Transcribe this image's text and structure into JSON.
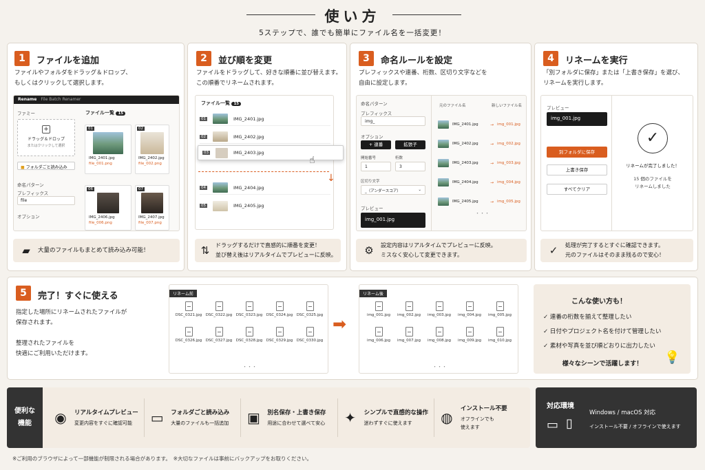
{
  "header": {
    "title": "使い方",
    "subtitle": "5ステップで、誰でも簡単にファイル名を一括変更！"
  },
  "step1": {
    "num": "1",
    "title": "ファイルを追加",
    "desc1": "ファイルやフォルダをドラッグ＆ドロップ、",
    "desc2": "もしくはクリックして選択します。",
    "app_name": "Rename",
    "app_sub": "File Batch Renamer",
    "files_label": "ファミー",
    "list_label": "ファイル一覧",
    "count": "15",
    "drop1": "ドラッグ＆ドロップ",
    "drop2": "またはクリックして選択",
    "folder_btn": "フォルダごと読み込み",
    "naming_label": "命名パターン",
    "prefix_label": "プレフィックス",
    "prefix_value": "file",
    "option_label": "オプション",
    "files": [
      {
        "n": "01",
        "a": "IMG_2401.jpg",
        "b": "file_001.png"
      },
      {
        "n": "02",
        "a": "IMG_2402.jpg",
        "b": "file_002.png"
      },
      {
        "n": "06",
        "a": "IMG_2406.jpg",
        "b": "file_006.png"
      },
      {
        "n": "07",
        "a": "IMG_2407.jpg",
        "b": "file_007.png"
      }
    ],
    "tip": "大量のファイルもまとめて読み込み可能！"
  },
  "step2": {
    "num": "2",
    "title": "並び順を変更",
    "desc1": "ファイルをドラッグして、好きな順番に並び替えます。",
    "desc2": "この順番でリネームされます。",
    "list_label": "ファイル一覧",
    "count": "15",
    "rows": [
      {
        "n": "01",
        "f": "IMG_2401.jpg"
      },
      {
        "n": "02",
        "f": "IMG_2402.jpg"
      },
      {
        "n": "03",
        "f": "IMG_2403.jpg"
      },
      {
        "n": "04",
        "f": "IMG_2404.jpg"
      },
      {
        "n": "05",
        "f": "IMG_2405.jpg"
      }
    ],
    "tip1": "ドラッグするだけで直感的に順番を変更！",
    "tip2": "並び替え後はリアルタイムでプレビューに反映。"
  },
  "step3": {
    "num": "3",
    "title": "命名ルールを設定",
    "desc1": "プレフィックスや連番、桁数、区切り文字などを",
    "desc2": "自由に設定します。",
    "naming_label": "命名パターン",
    "prefix_label": "プレフィックス",
    "prefix_value": "img_",
    "option_label": "オプション",
    "btn_seq": "+ 連番",
    "btn_ext": "拡張子",
    "start_label": "開始番号",
    "digits_label": "桁数",
    "start_value": "1",
    "digits_value": "3",
    "sep_label": "区切り文字",
    "sep_value": "_（アンダースコア）",
    "preview_label": "プレビュー",
    "preview_value": "img_001.jpg",
    "col_old": "元のファイル名",
    "col_new": "新しいファイル名",
    "rows": [
      {
        "a": "IMG_2401.jpg",
        "b": "img_001.jpg"
      },
      {
        "a": "IMG_2402.jpg",
        "b": "img_002.jpg"
      },
      {
        "a": "IMG_2403.jpg",
        "b": "img_003.jpg"
      },
      {
        "a": "IMG_2404.jpg",
        "b": "img_004.jpg"
      },
      {
        "a": "IMG_2405.jpg",
        "b": "img_005.jpg"
      }
    ],
    "tip1": "設定内容はリアルタイムでプレビューに反映。",
    "tip2": "ミスなく安心して変更できます。"
  },
  "step4": {
    "num": "4",
    "title": "リネームを実行",
    "desc1": "「別フォルダに保存」または「上書き保存」を選び、",
    "desc2": "リネームを実行します。",
    "preview_label": "プレビュー",
    "preview_value": "img_001.jpg",
    "btn_save_other": "別フォルダに保存",
    "btn_overwrite": "上書き保存",
    "btn_clear": "すべてクリア",
    "done": "リネームが完了しました！",
    "count1": "15 個のファイルを",
    "count2": "リネームしました",
    "tip1": "処理が完了するとすぐに確認できます。",
    "tip2": "元のファイルはそのまま残るので安心！"
  },
  "step5": {
    "num": "5",
    "title": "完了！すぐに使える",
    "desc1": "指定した場所にリネームされたファイルが",
    "desc2": "保存されます。",
    "desc3": "整理されたファイルを",
    "desc4": "快適にご利用いただけます。",
    "before_label": "リネーム前",
    "after_label": "リネーム後",
    "before": [
      "DSC_0321.jpg",
      "DSC_0322.jpg",
      "DSC_0323.jpg",
      "DSC_0324.jpg",
      "DSC_0325.jpg",
      "DSC_0326.jpg",
      "DSC_0327.jpg",
      "DSC_0328.jpg",
      "DSC_0329.jpg",
      "DSC_0330.jpg"
    ],
    "after": [
      "img_001.jpg",
      "img_002.jpg",
      "img_003.jpg",
      "img_004.jpg",
      "img_005.jpg",
      "img_006.jpg",
      "img_007.jpg",
      "img_008.jpg",
      "img_009.jpg",
      "img_010.jpg"
    ],
    "ellipsis": "・・・"
  },
  "usecases": {
    "title": "こんな使い方も！",
    "items": [
      "連番の桁数を揃えて整理したい",
      "日付やプロジェクト名を付けて管理したい",
      "素材や写真を並び順どおりに出力したい"
    ],
    "footer": "様々なシーンで活躍します！"
  },
  "features": {
    "label1": "便利な",
    "label2": "機能",
    "items": [
      {
        "icon": "eye-icon",
        "title": "リアルタイムプレビュー",
        "desc": "変更内容をすぐに確認可能"
      },
      {
        "icon": "folder-icon",
        "title": "フォルダごと読み込み",
        "desc": "大量のファイルも一括追加"
      },
      {
        "icon": "save-icon",
        "title": "別名保存・上書き保存",
        "desc": "用途に合わせて選べて安心"
      },
      {
        "icon": "magic-wand-icon",
        "title": "シンプルで直感的な操作",
        "desc": "迷わずすぐに使えます"
      },
      {
        "icon": "globe-icon",
        "title": "インストール不要",
        "desc": "オフラインでも",
        "desc2": "使えます"
      }
    ]
  },
  "env": {
    "title": "対応環境",
    "os": "Windows / macOS 対応",
    "note": "インストール不要 / オフラインで使えます"
  },
  "footnote": "※ご利用のブラウザによって一部機能が制限される場合があります。　※大切なファイルは事前にバックアップをお取りください。"
}
